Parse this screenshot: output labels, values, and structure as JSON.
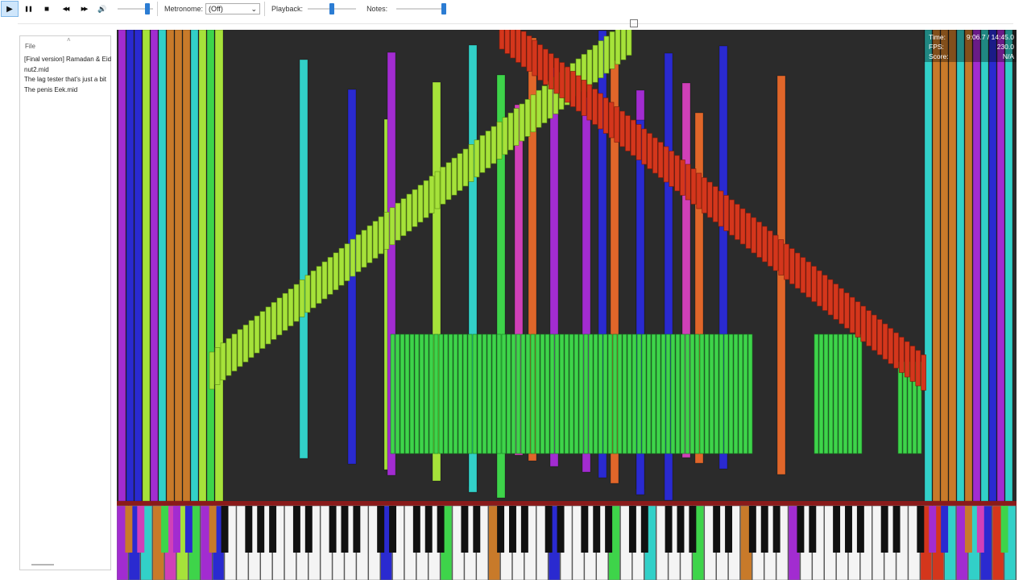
{
  "toolbar": {
    "buttons": [
      {
        "name": "play-button",
        "icon": "play-icon",
        "glyph": "▶",
        "active": true
      },
      {
        "name": "pause-button",
        "icon": "pause-icon",
        "glyph": "❚❚",
        "active": false
      },
      {
        "name": "stop-button",
        "icon": "stop-icon",
        "glyph": "■",
        "active": false
      },
      {
        "name": "rewind-button",
        "icon": "rewind-icon",
        "glyph": "◀◀",
        "active": false
      },
      {
        "name": "fast-forward-button",
        "icon": "fast-forward-icon",
        "glyph": "▶▶",
        "active": false
      },
      {
        "name": "volume-button",
        "icon": "speaker-icon",
        "glyph": "🔊",
        "active": false
      }
    ],
    "volume_level": 0.85,
    "metronome_label": "Metronome:",
    "metronome_value": "(Off)",
    "playback_label": "Playback:",
    "playback_level": 0.5,
    "notes_label": "Notes:",
    "notes_level": 0.95,
    "accent_color": "#2b7cd3"
  },
  "file_panel": {
    "caption": "File",
    "files": [
      "[Final version] Ramadan & Eid",
      "nut2.mid",
      "The lag tester that's just a bit",
      "The penis Eek.mid"
    ]
  },
  "hud": {
    "time_label": "Time:",
    "time_value": "9:06.7 / 14:45.0",
    "fps_label": "FPS:",
    "fps_value": "230.0",
    "score_label": "Score:",
    "score_value": "N/A"
  },
  "colors": {
    "background": "#2b2b2b",
    "lime": "#a6e23a",
    "green": "#3ed44a",
    "red": "#d4361c",
    "orange": "#e0662a",
    "blue": "#2a2ad0",
    "purple": "#a22cd0",
    "cyan": "#32d0c8",
    "brown": "#c87a2a",
    "magenta": "#d040b8"
  }
}
